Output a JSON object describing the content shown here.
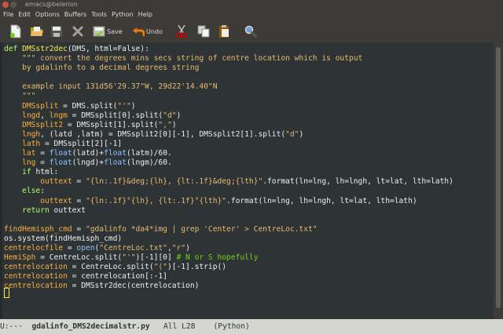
{
  "window": {
    "title": "emacs@belerion"
  },
  "menu": {
    "items": [
      "File",
      "Edit",
      "Options",
      "Buffers",
      "Tools",
      "Python",
      "Help"
    ]
  },
  "toolbar": {
    "save_label": "Save",
    "undo_label": "Undo",
    "icons": [
      "new-file-icon",
      "open-folder-icon",
      "floppy-disk-icon",
      "close-icon",
      "save-icon",
      "undo-icon",
      "cut-icon",
      "copy-icon",
      "paste-icon",
      "search-icon"
    ]
  },
  "editor": {
    "language": "Python",
    "lines": [
      "def DMSstr2dec(DMS, html=False):",
      "    \"\"\" convert the degrees mins secs string of centre location which is output",
      "    by gdalinfo to a decimal degrees string",
      "",
      "    example input 131d56'29.37\"W, 29d22'14.40\"N",
      "    \"\"\"",
      "    DMSsplit = DMS.split(\"'\")",
      "    lngd, lngm = DMSsplit[0].split(\"d\")",
      "    DMSsplit2 = DMSsplit[1].split(\",\")",
      "    lngh, (latd ,latm) = DMSsplit2[0][-1], DMSsplit2[1].split(\"d\")",
      "    lath = DMSsplit[2][-1]",
      "    lat = float(latd)+float(latm)/60.",
      "    lng = float(lngd)+float(lngm)/60.",
      "    if html:",
      "        outtext = \"{ln:.1f}&deg;{lh}, {lt:.1f}&deg;{lth}\".format(ln=lng, lh=lngh, lt=lat, lth=lath)",
      "    else:",
      "        outtext = \"{ln:.1f}°{lh}, {lt:.1f}°{lth}\".format(ln=lng, lh=lngh, lt=lat, lth=lath)",
      "    return outtext",
      "",
      "findHemisph_cmd = \"gdalinfo *da4*img | grep 'Center' > CentreLoc.txt\"",
      "os.system(findHemisph_cmd)",
      "centrelocfile = open(\"CentreLoc.txt\",\"r\")",
      "HemiSph = CentreLoc.split(\"'\")[-1][0] # N or S hopefully",
      "centrelocation = CentreLoc.split(\"(\")[-1].strip()",
      "centrelocation = centrelocation[:-1]",
      "centrelocation = DMSstr2dec(centrelocation)"
    ]
  },
  "modeline": {
    "status": "U:---",
    "buffer_name": "gdalinfo_DMS2decimalstr.py",
    "position": "All L28",
    "mode": "(Python)"
  }
}
